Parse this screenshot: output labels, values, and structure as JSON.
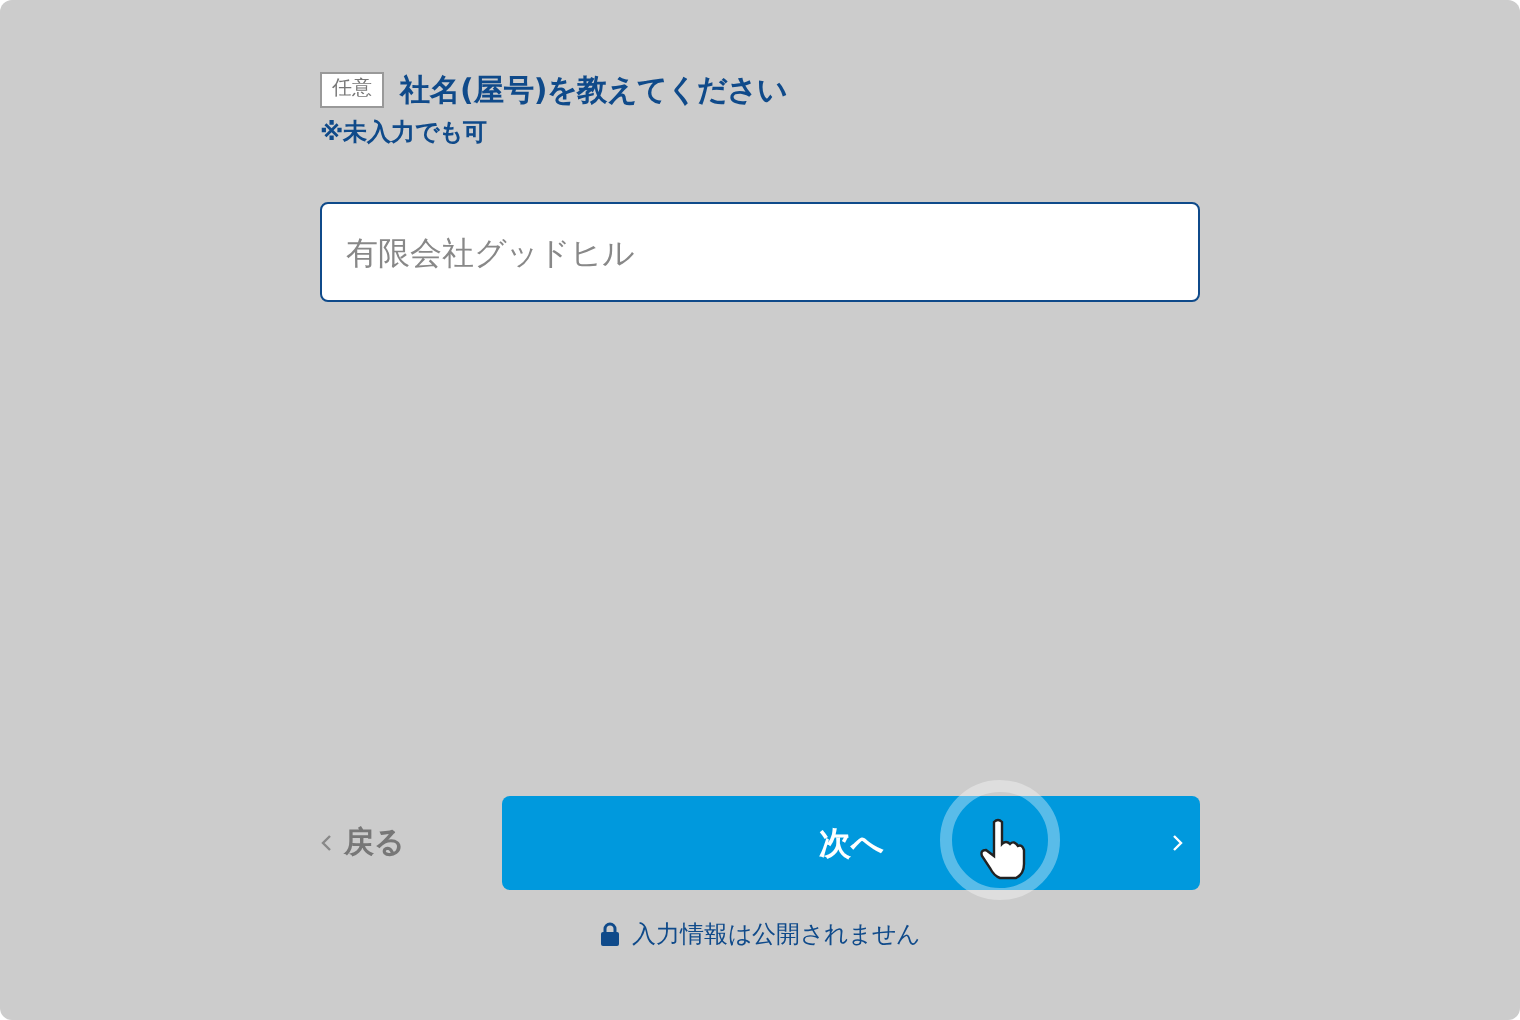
{
  "question": {
    "badge": "任意",
    "title": "社名(屋号)を教えてください",
    "note": "※未入力でも可"
  },
  "field": {
    "placeholder": "有限会社グッドヒル"
  },
  "back_button": {
    "label": "戻る"
  },
  "next_button": {
    "label": "次へ"
  },
  "privacy_note": "入力情報は公開されません"
}
